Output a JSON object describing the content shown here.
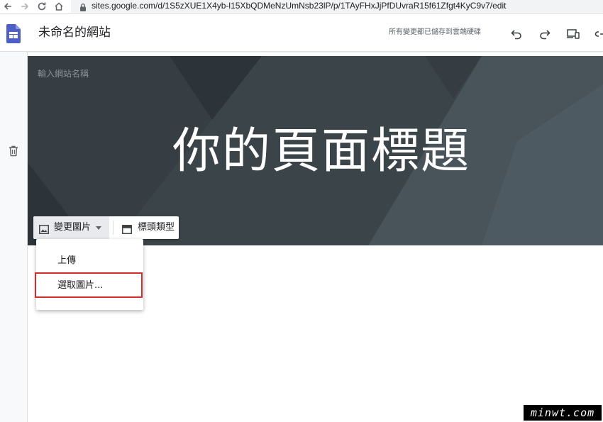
{
  "browser": {
    "url": "sites.google.com/d/1S5zXUE1X4yb-l15XbQDMeNzUmNsb23lP/p/1TAyFHxJjPfDUvraR15f61Zfgt4KyC9v7/edit"
  },
  "header": {
    "site_title": "未命名的網站",
    "save_status": "所有變更都已儲存到雲端硬碟"
  },
  "banner": {
    "site_name_placeholder": "輸入網站名稱",
    "page_title": "你的頁面標題",
    "toolbar": {
      "change_image_label": "變更圖片",
      "header_type_label": "標頭類型"
    }
  },
  "menu": {
    "items": [
      {
        "label": "上傳"
      },
      {
        "label": "選取圖片..."
      }
    ]
  },
  "watermark": {
    "text": "minwt.com"
  },
  "colors": {
    "banner_bg": "#343c42",
    "highlight": "#d62b2b",
    "docs_blue": "#4f5fc8"
  }
}
